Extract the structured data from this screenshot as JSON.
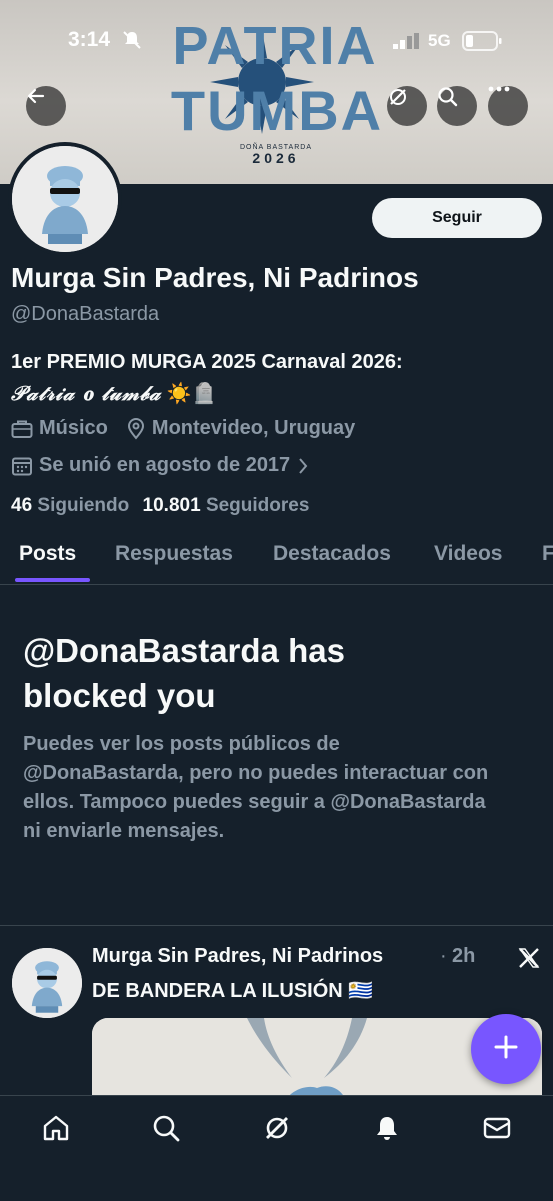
{
  "status_bar": {
    "time": "3:14",
    "network": "5G"
  },
  "banner": {
    "title_line1": "PATRIA",
    "title_line2": "TUMBA",
    "subtitle": "DOÑA BASTARDA",
    "year": "2026"
  },
  "profile": {
    "display_name": "Murga Sin Padres, Ni Padrinos",
    "handle": "@DonaBastarda",
    "bio_line1": "1er PREMIO MURGA 2025 Carnaval 2026:",
    "bio_line2_script": "𝒫𝒶𝓉𝓇𝒾𝒶 𝐨 𝓉𝓊𝓂𝒷𝒶",
    "bio_emoji": "☀️🪦",
    "profession": "Músico",
    "location": "Montevideo, Uruguay",
    "joined": "Se unió en agosto de 2017",
    "following_count": "46",
    "following_label": "Siguiendo",
    "followers_count": "10.801",
    "followers_label": "Seguidores",
    "follow_button": "Seguir"
  },
  "tabs": [
    {
      "label": "Posts",
      "active": true
    },
    {
      "label": "Respuestas"
    },
    {
      "label": "Destacados"
    },
    {
      "label": "Videos"
    },
    {
      "label": "F"
    }
  ],
  "blocked": {
    "title": "@DonaBastarda has blocked you",
    "body": "Puedes ver los posts públicos de @DonaBastarda, pero no puedes interactuar con ellos. Tampoco puedes seguir a @DonaBastarda ni enviarle mensajes."
  },
  "post": {
    "author": "Murga Sin Padres, Ni Padrinos",
    "separator": "·",
    "time": "2h",
    "text": "DE BANDERA LA ILUSIÓN 🇺🇾"
  },
  "icons": {
    "back": "back-arrow-icon",
    "grok": "grok-icon",
    "search": "search-icon",
    "more": "more-icon",
    "briefcase": "briefcase-icon",
    "location": "location-pin-icon",
    "calendar": "calendar-icon",
    "x_logo": "x-logo-icon",
    "compose": "plus-icon",
    "nav": [
      "home-icon",
      "search-icon",
      "grok-icon",
      "bell-icon",
      "mail-icon"
    ]
  },
  "colors": {
    "accent": "#7856ff",
    "background": "#15202b",
    "secondary_text": "#8b98a5",
    "banner_blue": "#4f7fa8"
  }
}
